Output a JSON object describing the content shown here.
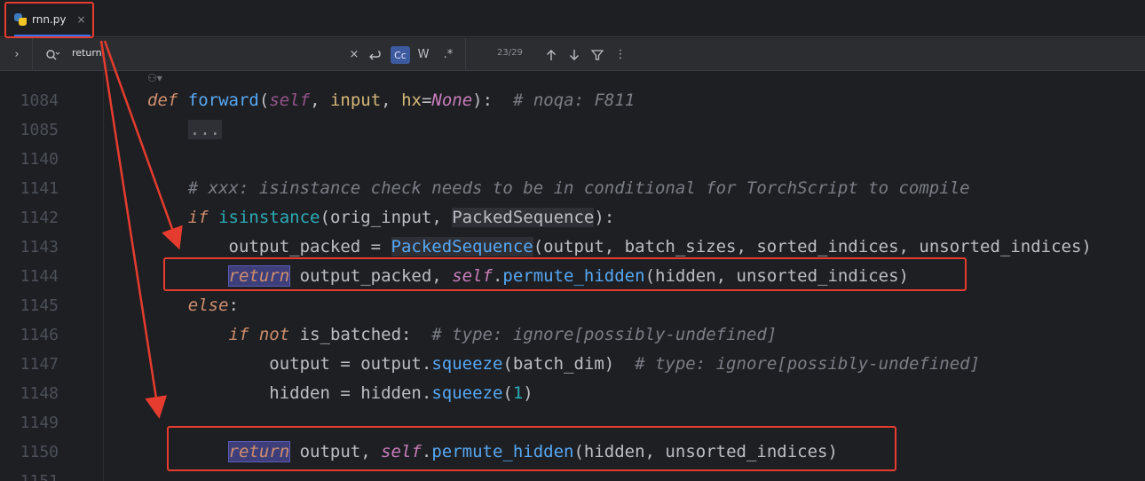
{
  "tab": {
    "filename": "rnn.py",
    "close_glyph": "×"
  },
  "find": {
    "query": "return",
    "case_label": "Cc",
    "words_label": "W",
    "regex_label": ".*",
    "match_count": "23/29"
  },
  "colors": {
    "accent": "#3574f0",
    "annotation_red": "#e53c2f"
  },
  "lines": [
    {
      "num": "1084"
    },
    {
      "num": "1085"
    },
    {
      "num": "1140"
    },
    {
      "num": "1141"
    },
    {
      "num": "1142"
    },
    {
      "num": "1143"
    },
    {
      "num": "1144"
    },
    {
      "num": "1145"
    },
    {
      "num": "1146"
    },
    {
      "num": "1147"
    },
    {
      "num": "1148"
    },
    {
      "num": "1149"
    },
    {
      "num": "1150"
    },
    {
      "num": "1151"
    }
  ],
  "code": {
    "l1084": {
      "def": "def",
      "name": "forward",
      "open": "(",
      "self": "self",
      "c1": ", ",
      "input": "input",
      "c2": ", ",
      "hx": "hx",
      "eq": "=",
      "none": "None",
      "close": "):",
      "comment": "# noqa: F811"
    },
    "l1085": {
      "fold": "..."
    },
    "l1141": {
      "comment": "# xxx: isinstance check needs to be in conditional for TorchScript to compile"
    },
    "l1142": {
      "if": "if",
      "fn": "isinstance",
      "args1": "(orig_input, ",
      "cls": "PackedSequence",
      "args2": "):"
    },
    "l1143": {
      "lhs": "output_packed = ",
      "cls": "PackedSequence",
      "args": "(output, batch_sizes, sorted_indices, unsorted_indices)"
    },
    "l1144": {
      "ret": "return",
      "mid": " output_packed, ",
      "self": "self",
      "dot": ".",
      "fn": "permute_hidden",
      "args": "(hidden, unsorted_indices)"
    },
    "l1145": {
      "else": "else",
      "colon": ":"
    },
    "l1146": {
      "if": "if",
      "not": "not",
      "rest": " is_batched:  ",
      "comment": "# type: ignore[possibly-undefined]"
    },
    "l1147": {
      "lhs": "output = output.",
      "fn": "squeeze",
      "args": "(batch_dim)  ",
      "comment": "# type: ignore[possibly-undefined]"
    },
    "l1148": {
      "lhs": "hidden = hidden.",
      "fn": "squeeze",
      "open": "(",
      "num": "1",
      "close": ")"
    },
    "l1150": {
      "ret": "return",
      "mid": " output, ",
      "self": "self",
      "dot": ".",
      "fn": "permute_hidden",
      "args": "(hidden, unsorted_indices)"
    }
  }
}
